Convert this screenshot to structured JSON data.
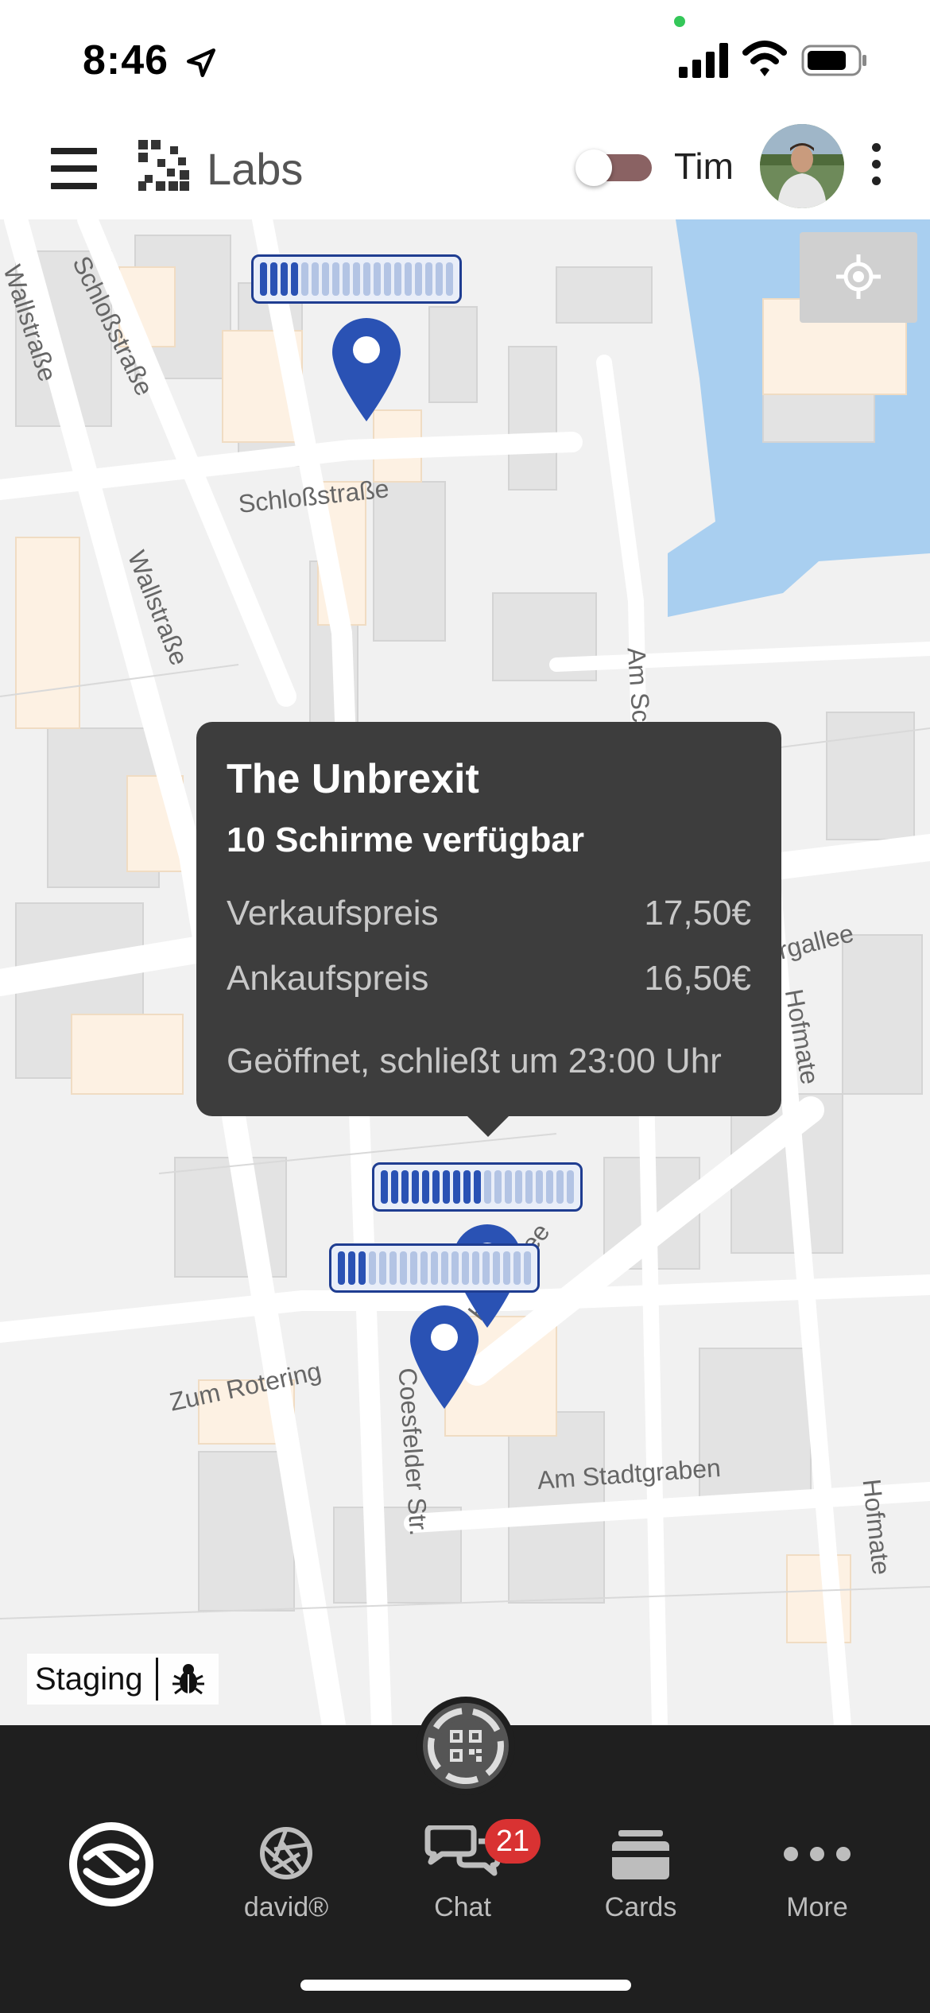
{
  "status_bar": {
    "time": "8:46"
  },
  "header": {
    "brand": "Labs",
    "user_name": "Tim"
  },
  "map": {
    "streets": [
      "Wallstraße",
      "Schloßstraße",
      "Schloßstraße",
      "Wallstraße",
      "Am Sch",
      "Zum Rotering",
      "Coesfelder Str.",
      "Am Stadtgraben",
      "Hofmate",
      "Hofmate",
      "rgallee",
      "Hlgrgallee"
    ],
    "capacity_markers": [
      {
        "filled": 4,
        "total": 19
      },
      {
        "filled": 10,
        "total": 19
      },
      {
        "filled": 3,
        "total": 19
      }
    ]
  },
  "popup": {
    "title": "The Unbrexit",
    "subtitle": "10 Schirme verfügbar",
    "rows": [
      {
        "label": "Verkaufspreis",
        "value": "17,50€"
      },
      {
        "label": "Ankaufspreis",
        "value": "16,50€"
      }
    ],
    "hours": "Geöffnet, schließt um 23:00 Uhr"
  },
  "staging": {
    "label": "Staging"
  },
  "bottom_nav": {
    "items": [
      {
        "label": ""
      },
      {
        "label": "david®"
      },
      {
        "label": "Chat"
      },
      {
        "label": "Cards"
      },
      {
        "label": "More"
      }
    ],
    "chat_badge": "21"
  },
  "colors": {
    "accent": "#2a52b4",
    "popup_bg": "#3d3d3d",
    "nav_bg": "#1f1f1f",
    "badge": "#d93232"
  }
}
